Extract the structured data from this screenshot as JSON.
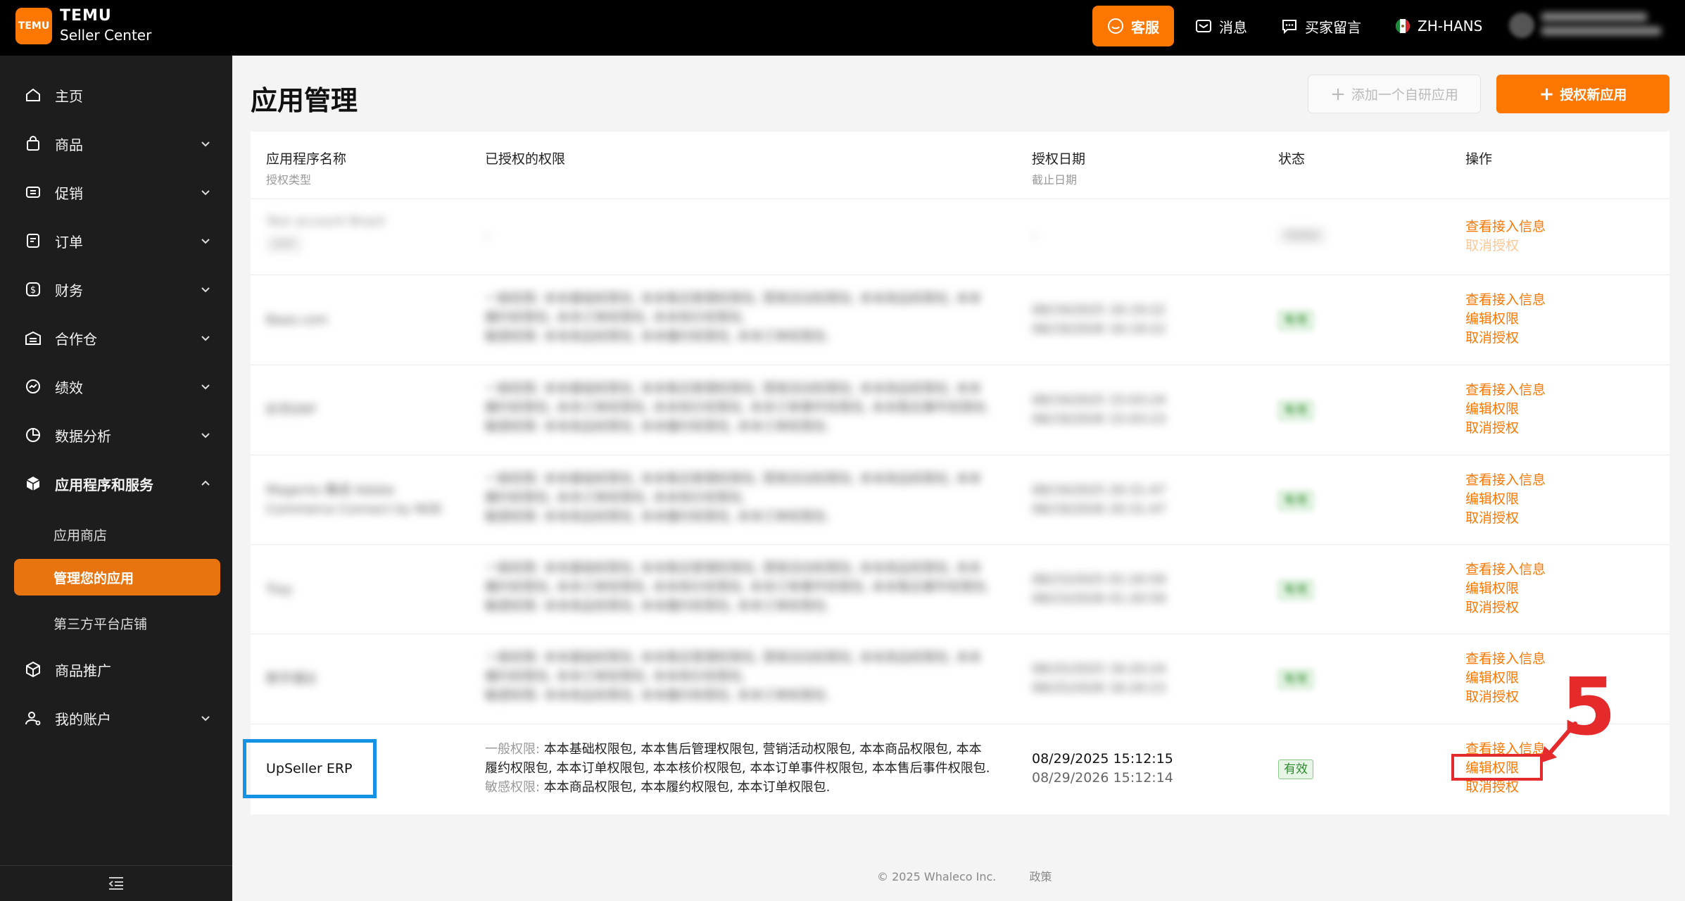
{
  "topbar": {
    "logo_text": "TEMU",
    "brand_title": "TEMU",
    "brand_subtitle": "Seller Center",
    "customer_service": "客服",
    "messages": "消息",
    "buyer_messages": "买家留言",
    "language": "ZH-HANS"
  },
  "sidebar": {
    "items": [
      {
        "label": "主页"
      },
      {
        "label": "商品"
      },
      {
        "label": "促销"
      },
      {
        "label": "订单"
      },
      {
        "label": "财务"
      },
      {
        "label": "合作仓"
      },
      {
        "label": "绩效"
      },
      {
        "label": "数据分析"
      },
      {
        "label": "应用程序和服务"
      },
      {
        "label": "商品推广"
      },
      {
        "label": "我的账户"
      }
    ],
    "sub_items": [
      "应用商店",
      "管理您的应用",
      "第三方平台店铺"
    ]
  },
  "main": {
    "title": "应用管理",
    "add_own_app": "添加一个自研应用",
    "authorize_new_app": "授权新应用",
    "columns": {
      "app_name": "应用程序名称",
      "auth_type": "授权类型",
      "permissions": "已授权的权限",
      "auth_date": "授权日期",
      "expire_date": "截止日期",
      "status": "状态",
      "actions": "操作"
    },
    "rows": [
      {
        "name": "Test account Brazil",
        "type": "ERP",
        "permissions": [
          "-"
        ],
        "auth_date": "-",
        "expire": "",
        "status": "待授权",
        "actions": [
          "查看接入信息",
          "取消授权"
        ]
      },
      {
        "name": "Base.com",
        "permissions": [
          "一般权限: 本本基础权限包, 本本售后管理权限包, 营销活动权限包, 本本商品权限包, 本本",
          "履约权限包, 本本订单权限包, 本本核价权限包,",
          "敏感权限: 本本商品权限包, 本本履约权限包, 本本订单权限包."
        ],
        "auth_date": "08/19/2025 16:19:22",
        "expire": "08/19/2026 16:19:22",
        "status": "有效",
        "actions": [
          "查看接入信息",
          "编辑权限",
          "取消授权"
        ]
      },
      {
        "name": "妙手ERP",
        "permissions": [
          "一般权限: 本本基础权限包, 本本售后管理权限包, 营销活动权限包, 本本商品权限包, 本本",
          "履约权限包, 本本订单权限包, 本本核价权限包, 本本订单事件权限包, 本本售后事件权限包.",
          "敏感权限: 本本商品权限包, 本本履约权限包, 本本订单权限包."
        ],
        "auth_date": "08/19/2025 15:03:24",
        "expire": "08/19/2026 15:03:23",
        "status": "有效",
        "actions": [
          "查看接入信息",
          "编辑权限",
          "取消授权"
        ]
      },
      {
        "name": "Magento 集成 Adobe Commerce Connect by NOE",
        "permissions": [
          "一般权限: 本本基础权限包, 本本售后管理权限包, 营销活动权限包, 本本商品权限包, 本本",
          "履约权限包, 本本订单权限包, 本本核价权限包,",
          "敏感权限: 本本商品权限包, 本本履约权限包, 本本订单权限包."
        ],
        "auth_date": "08/19/2025 20:31:47",
        "expire": "08/19/2026 20:31:47",
        "status": "有效",
        "actions": [
          "查看接入信息",
          "编辑权限",
          "取消授权"
        ]
      },
      {
        "name": "Tray",
        "permissions": [
          "一般权限: 本本基础权限包, 本本售后管理权限包, 营销活动权限包, 本本商品权限包, 本本",
          "履约权限包, 本本订单权限包, 本本核价权限包, 本本订单事件权限包, 本本售后事件权限包.",
          "敏感权限: 本本商品权限包, 本本履约权限包, 本本订单权限包."
        ],
        "auth_date": "08/23/2025 01:20:59",
        "expire": "08/23/2026 01:20:59",
        "status": "有效",
        "actions": [
          "查看接入信息",
          "编辑权限",
          "取消授权"
        ]
      },
      {
        "name": "数字通达",
        "permissions": [
          "一般权限: 本本基础权限包, 本本售后管理权限包, 营销活动权限包, 本本商品权限包, 本本",
          "履约权限包, 本本订单权限包, 本本核价权限包,",
          "敏感权限: 本本商品权限包, 本本履约权限包, 本本订单权限包."
        ],
        "auth_date": "08/25/2025 16:20:24",
        "expire": "08/25/2026 16:20:23",
        "status": "有效",
        "actions": [
          "查看接入信息",
          "编辑权限",
          "取消授权"
        ]
      },
      {
        "name": "UpSeller ERP",
        "perm_general_label": "一般权限:",
        "perm_general_1": " 本本基础权限包, 本本售后管理权限包, 营销活动权限包, 本本商品权限包, 本本",
        "perm_general_2": "履约权限包, 本本订单权限包, 本本核价权限包, 本本订单事件权限包, 本本售后事件权限包.",
        "perm_sensitive_label": "敏感权限:",
        "perm_sensitive": " 本本商品权限包, 本本履约权限包, 本本订单权限包.",
        "auth_date": "08/29/2025 15:12:15",
        "expire": "08/29/2026 15:12:14",
        "status": "有效",
        "action_view": "查看接入信息",
        "action_edit": "编辑权限",
        "action_cancel": "取消授权"
      }
    ]
  },
  "footer": {
    "copyright": "© 2025 Whaleco Inc.",
    "policy": "政策"
  },
  "annotation": {
    "step": "5"
  },
  "colors": {
    "brand": "#fb7701",
    "highlight_blue": "#1592e6",
    "highlight_red": "#e42a2a"
  }
}
